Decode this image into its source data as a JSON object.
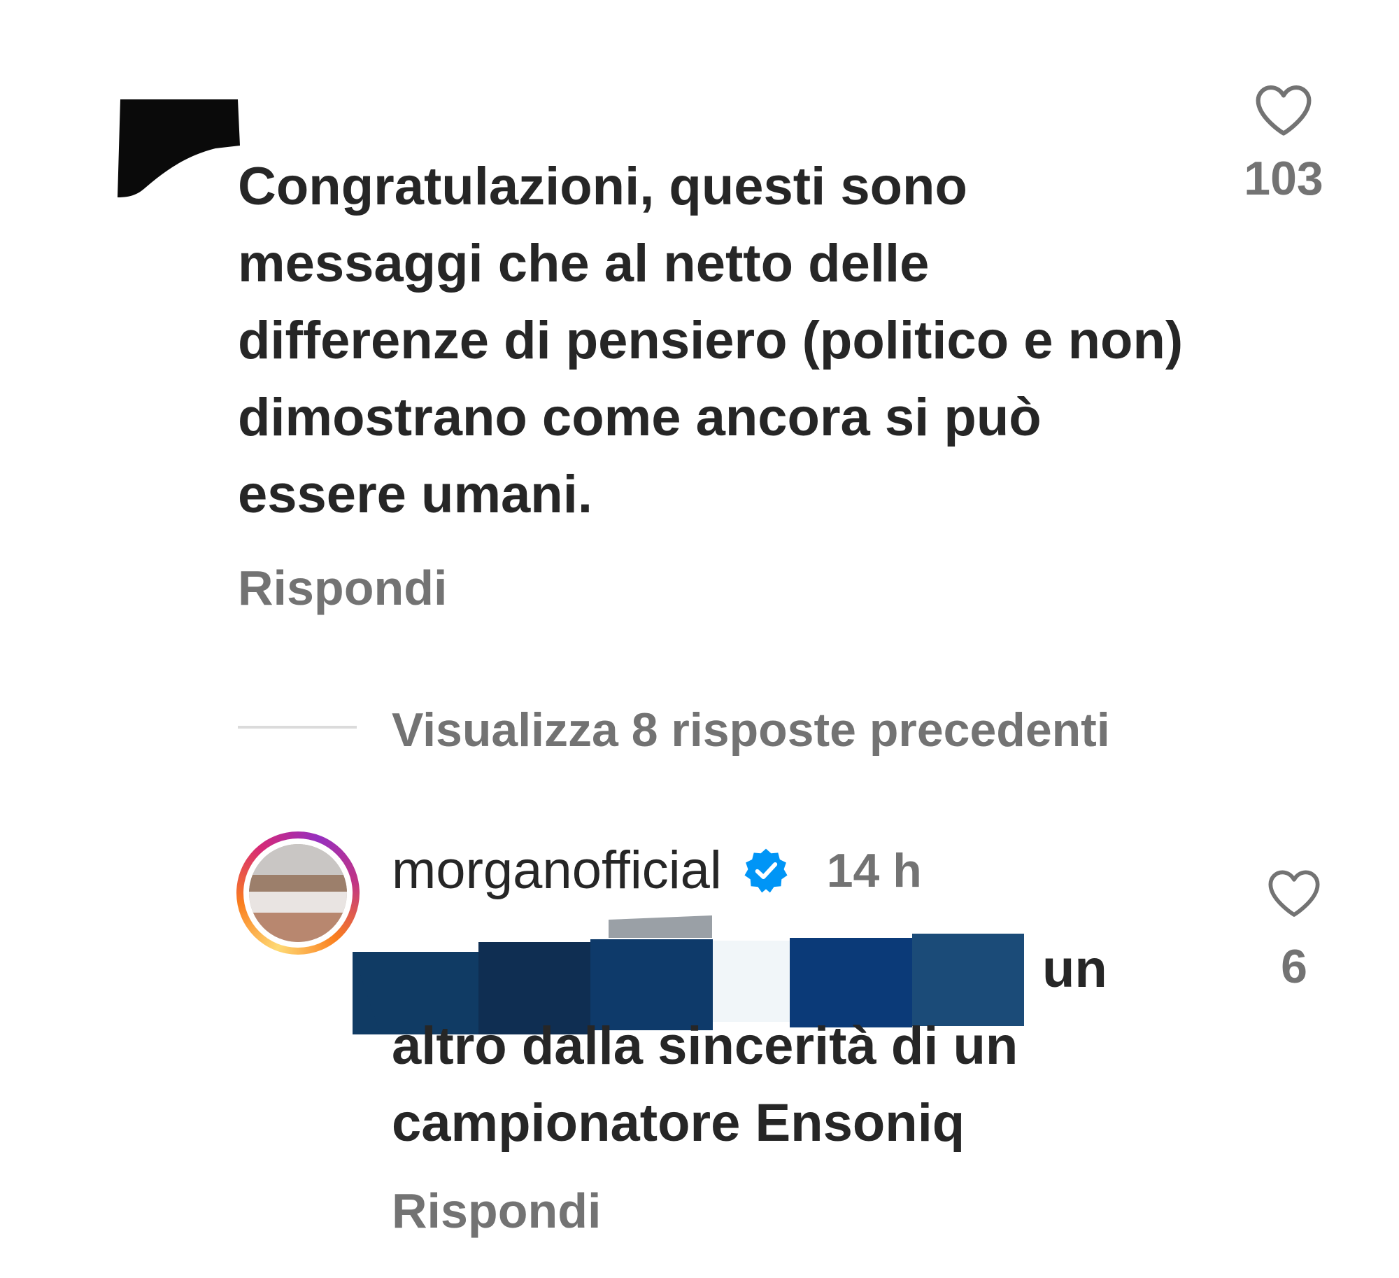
{
  "comment_1": {
    "text": "Congratulazioni, questi sono messaggi che al netto delle differenze di pensiero (politico e non) dimostrano come ancora si può essere umani.",
    "reply_label": "Rispondi",
    "like_count": "103",
    "like_icon": "heart-outline-icon"
  },
  "thread": {
    "view_previous_label": "Visualizza 8 risposte precedenti"
  },
  "comment_2": {
    "username": "morganofficial",
    "verified_icon": "verified-badge-icon",
    "time": "14 h",
    "text_line1_visible": "un",
    "text_rest": "altro dalla sincerità di un\ncampionatore Ensoniq",
    "reply_label": "Rispondi",
    "like_count": "6",
    "like_icon": "heart-outline-icon"
  },
  "colors": {
    "text": "#262626",
    "secondary": "#737373",
    "verified": "#0095f6",
    "divider": "#dbdbdb"
  }
}
